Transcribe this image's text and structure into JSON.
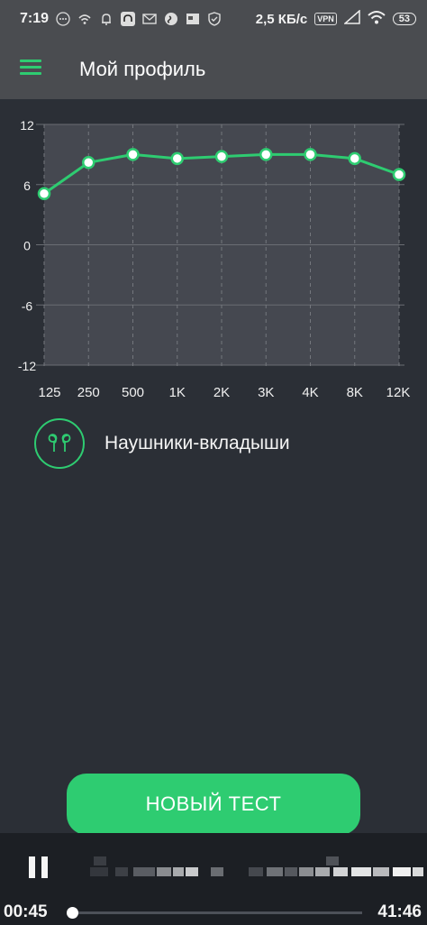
{
  "status_bar": {
    "time": "7:19",
    "net_speed": "2,5 КБ/с",
    "vpn": "VPN",
    "battery": "53"
  },
  "app_bar": {
    "title": "Мой профиль",
    "menu_icon": "hamburger-menu-icon",
    "accent_color": "#2ecc71"
  },
  "chart_data": {
    "type": "line",
    "categories": [
      "125",
      "250",
      "500",
      "1K",
      "2K",
      "3K",
      "4K",
      "8K",
      "12K"
    ],
    "series": [
      {
        "values": [
          5.1,
          8.2,
          9.0,
          8.6,
          8.8,
          9.0,
          9.0,
          8.6,
          7.0
        ]
      }
    ],
    "y_ticks": [
      "12",
      "6",
      "0",
      "-6",
      "-12"
    ],
    "ylim": [
      -12,
      12
    ],
    "grid": true,
    "line_color": "#2ecc71"
  },
  "device": {
    "label": "Наушники-вкладыши",
    "icon": "earbuds-icon"
  },
  "new_test_button": "НОВЫЙ ТЕСТ",
  "player": {
    "elapsed": "00:45",
    "remaining": "41:46",
    "progress": 0.0
  }
}
